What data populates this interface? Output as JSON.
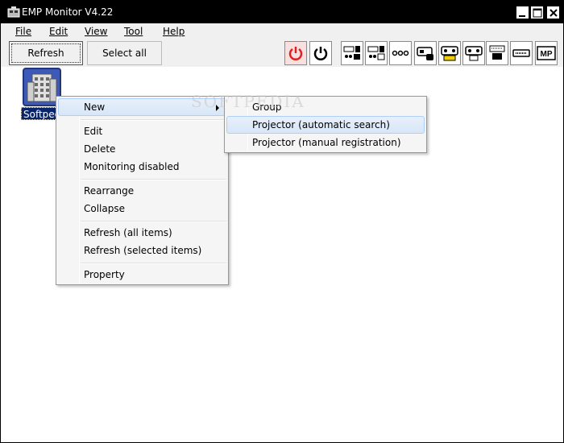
{
  "window": {
    "title": "EMP Monitor V4.22"
  },
  "menubar": {
    "items": [
      "File",
      "Edit",
      "View",
      "Tool",
      "Help"
    ]
  },
  "toolbar": {
    "refresh_label": "Refresh",
    "select_all_label": "Select all",
    "icon_buttons": [
      "power-on-icon",
      "power-off-icon",
      "input-1-icon",
      "input-2-icon",
      "no-signal-icon",
      "s-video-icon",
      "video-icon",
      "component-icon",
      "computer-icon",
      "hdmi-icon",
      "mp-icon"
    ],
    "mp_text": "MP"
  },
  "content": {
    "device_label": "Softpedia"
  },
  "context_menu": {
    "new": "New",
    "edit": "Edit",
    "delete": "Delete",
    "monitoring_disabled": "Monitoring disabled",
    "rearrange": "Rearrange",
    "collapse": "Collapse",
    "refresh_all": "Refresh (all items)",
    "refresh_selected": "Refresh (selected items)",
    "property": "Property"
  },
  "submenu": {
    "group": "Group",
    "projector_auto": "Projector (automatic search)",
    "projector_manual": "Projector (manual registration)"
  },
  "watermark": "SOFTPEDIA"
}
